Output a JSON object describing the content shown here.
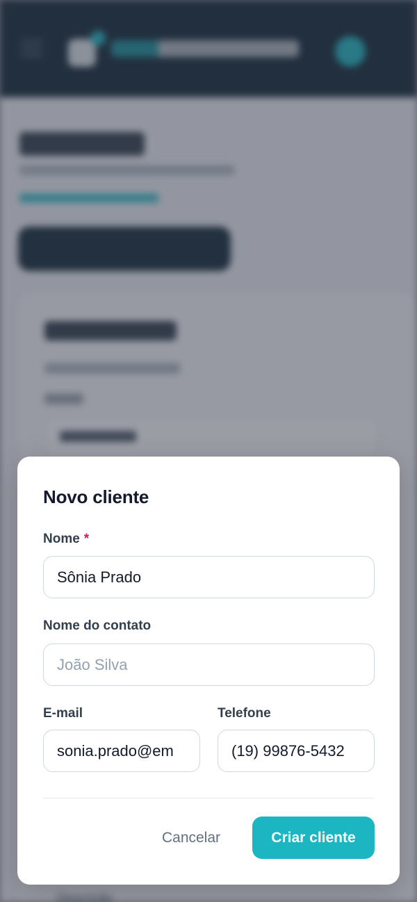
{
  "background": {
    "description_label": "Descrição"
  },
  "modal": {
    "title": "Novo cliente",
    "name_label": "Nome",
    "required_mark": "*",
    "name_value": "Sônia Prado",
    "contact_label": "Nome do contato",
    "contact_placeholder": "João Silva",
    "email_label": "E-mail",
    "email_value": "sonia.prado@em",
    "phone_label": "Telefone",
    "phone_value": "(19) 99876-5432",
    "cancel_label": "Cancelar",
    "submit_label": "Criar cliente"
  },
  "colors": {
    "accent": "#1bb6c1",
    "required": "#d3195a",
    "header_bg": "#0d2331"
  }
}
